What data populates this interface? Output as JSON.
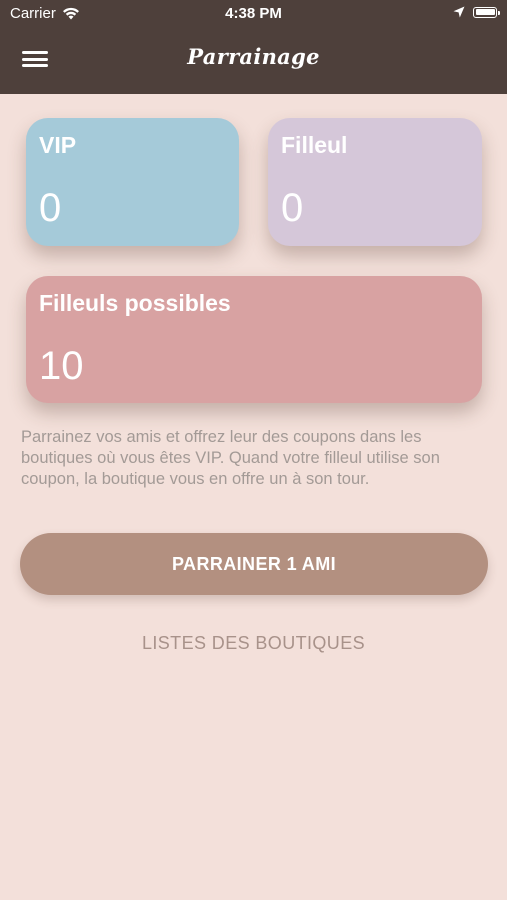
{
  "status_bar": {
    "carrier": "Carrier",
    "time": "4:38 PM"
  },
  "nav": {
    "title": "Parrainage"
  },
  "cards": {
    "vip": {
      "label": "VIP",
      "value": "0",
      "color": "#a5cad9"
    },
    "filleul": {
      "label": "Filleul",
      "value": "0",
      "color": "#d5c7d9"
    },
    "possible": {
      "label": "Filleuls possibles",
      "value": "10",
      "color": "#d8a2a2"
    }
  },
  "info_text": "Parrainez vos amis et offrez leur des coupons dans les boutiques où vous êtes VIP. Quand votre filleul utilise son coupon, la boutique vous en offre un à son tour.",
  "buttons": {
    "sponsor": "PARRAINER 1 AMI",
    "shops": "LISTES DES BOUTIQUES"
  },
  "colors": {
    "background": "#f3e0da",
    "header": "#4e403b",
    "primary_button": "#b39080",
    "link": "#a8928a"
  }
}
